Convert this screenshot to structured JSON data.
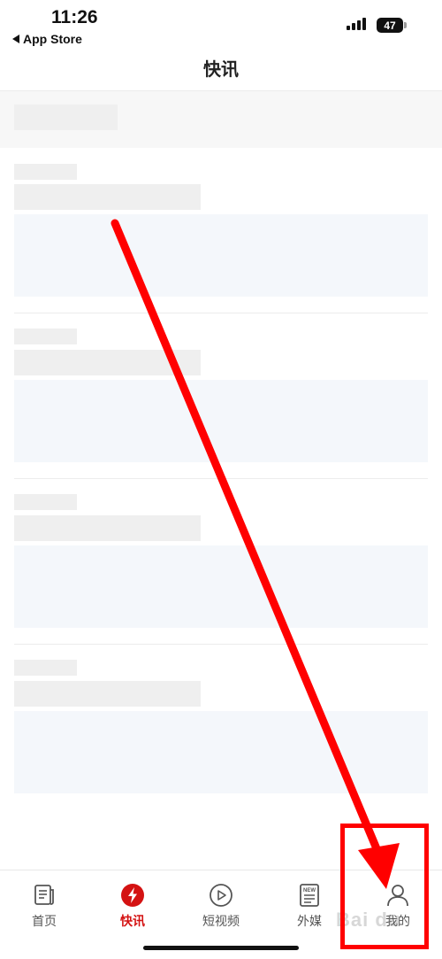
{
  "status_bar": {
    "time": "11:26",
    "back_label": "App Store",
    "battery": "47"
  },
  "header": {
    "title": "快讯"
  },
  "tabs": [
    {
      "label": "首页",
      "icon": "newspaper-icon"
    },
    {
      "label": "快讯",
      "icon": "lightning-icon",
      "active": true
    },
    {
      "label": "短视频",
      "icon": "play-circle-icon"
    },
    {
      "label": "外媒",
      "icon": "news-new-icon",
      "badge": "NEW"
    },
    {
      "label": "我的",
      "icon": "person-icon"
    }
  ],
  "watermark": "Bai du",
  "colors": {
    "accent": "#d41212",
    "annotation": "#ff0000"
  }
}
